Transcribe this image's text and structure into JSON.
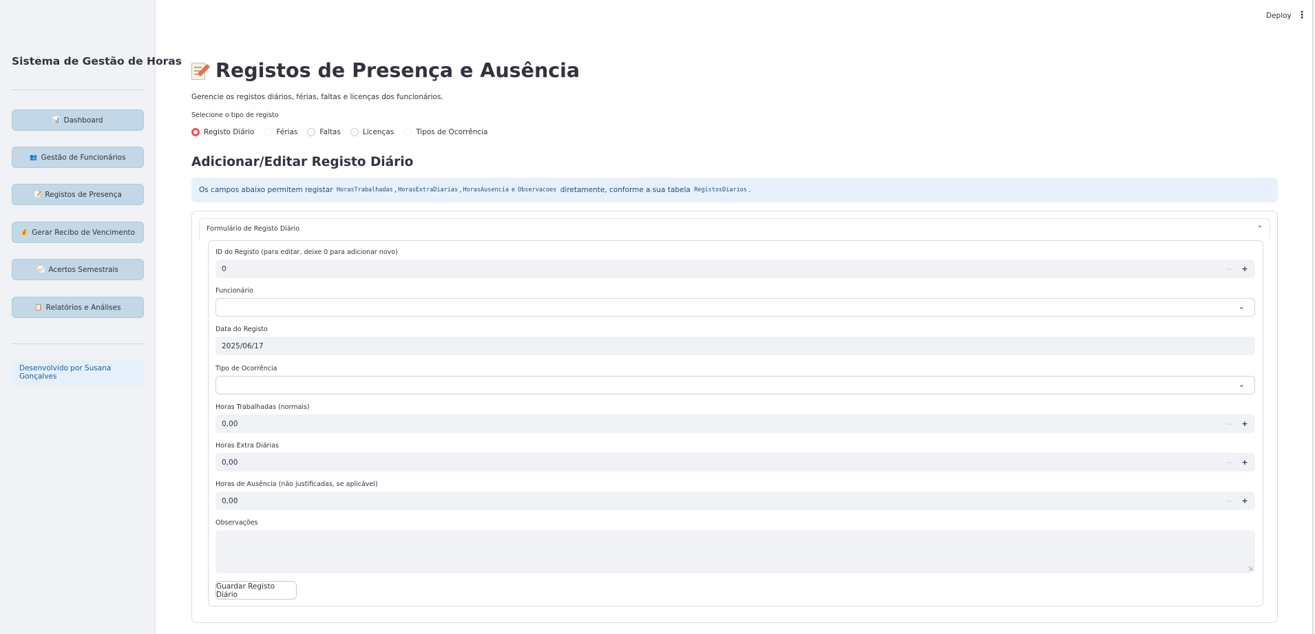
{
  "sidebar": {
    "title": "Sistema de Gestão de Horas",
    "items": [
      {
        "icon": "📊",
        "label": "Dashboard"
      },
      {
        "icon": "👥",
        "label": "Gestão de Funcionários"
      },
      {
        "icon": "📝",
        "label": "Registos de Presença"
      },
      {
        "icon": "💰",
        "label": "Gerar Recibo de Vencimento"
      },
      {
        "icon": "📈",
        "label": "Acertos Semestrais"
      },
      {
        "icon": "📋",
        "label": "Relatórios e Análises"
      }
    ],
    "credit": "Desenvolvido por Susana Gonçalves"
  },
  "header": {
    "deploy_label": "Deploy",
    "menu_glyph": "⋮"
  },
  "main": {
    "title": "Registos de Presença e Ausência",
    "description": "Gerencie os registos diários, férias, faltas e licenças dos funcionários.",
    "radio_label": "Selecione o tipo de registo",
    "radio_options": [
      "Registo Diário",
      "Férias",
      "Faltas",
      "Licenças",
      "Tipos de Ocorrência"
    ],
    "selected_option": "Registo Diário",
    "section_title": "Adicionar/Editar Registo Diário",
    "info": {
      "prefix": "Os campos abaixo permitem registar",
      "code1": "HorasTrabalhadas",
      "code2": "HorasExtraDiarias",
      "code3": "HorasAusencia",
      "e": "e",
      "code4": "Observacoes",
      "middle": "diretamente, conforme a sua tabela",
      "code5": "RegistosDiarios"
    },
    "form": {
      "expander_title": "Formulário de Registo Diário",
      "id_label": "ID do Registo (para editar, deixe 0 para adicionar novo)",
      "id_value": "0",
      "funcionario_label": "Funcionário",
      "date_label": "Data do Registo",
      "date_value": "2025/06/17",
      "ocorrencia_label": "Tipo de Ocorrência",
      "horas_trab_label": "Horas Trabalhadas (normais)",
      "horas_trab_value": "0,00",
      "horas_extra_label": "Horas Extra Diárias",
      "horas_extra_value": "0,00",
      "horas_aus_label": "Horas de Ausência (não justificadas, se aplicável)",
      "horas_aus_value": "0,00",
      "obs_label": "Observações",
      "save_label": "Guardar Registo Diário"
    }
  }
}
